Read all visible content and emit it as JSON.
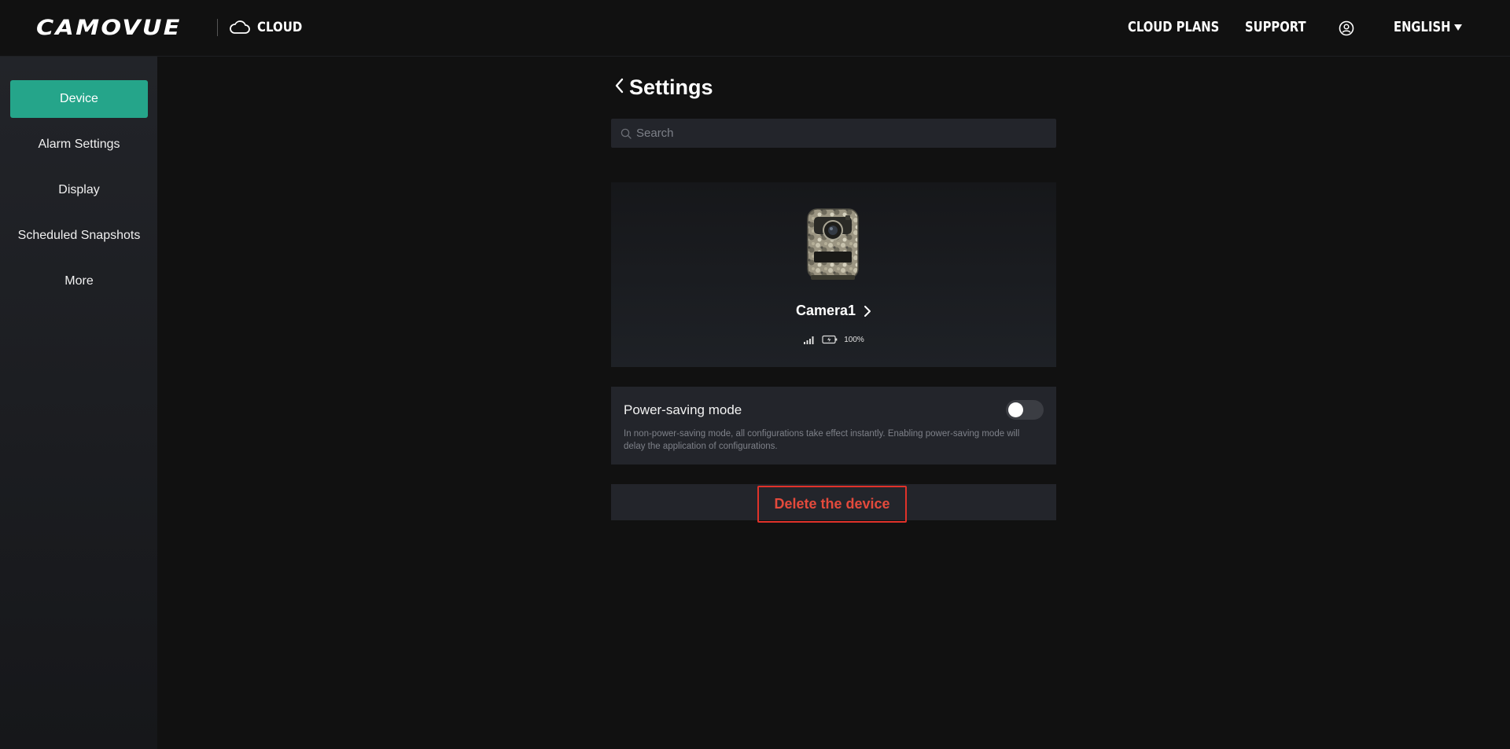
{
  "header": {
    "logo": "CAMOVUE",
    "brand_label": "CLOUD",
    "nav": {
      "cloud_plans": "CLOUD PLANS",
      "support": "SUPPORT",
      "language": "ENGLISH"
    },
    "icons": {
      "cloud": "cloud-icon",
      "user": "user-circle-icon",
      "language_caret": "caret-down-icon"
    }
  },
  "sidebar": {
    "items": [
      {
        "label": "Device",
        "active": true
      },
      {
        "label": "Alarm Settings",
        "active": false
      },
      {
        "label": "Display",
        "active": false
      },
      {
        "label": "Scheduled Snapshots",
        "active": false
      },
      {
        "label": "More",
        "active": false
      }
    ]
  },
  "main": {
    "title": "Settings",
    "search": {
      "placeholder": "Search",
      "value": ""
    },
    "device": {
      "name": "Camera1",
      "battery": "100%",
      "icons": [
        "signal-bars-icon",
        "battery-icon",
        "chevron-right-icon"
      ]
    },
    "power_saving": {
      "title": "Power-saving mode",
      "enabled": false,
      "description": "In non-power-saving mode, all configurations take effect instantly. Enabling power-saving mode will delay the application of configurations."
    },
    "delete_button": "Delete the device"
  },
  "colors": {
    "accent": "#25a58a",
    "background": "#111111",
    "panel": "#23252b",
    "danger": "#e0322a"
  }
}
